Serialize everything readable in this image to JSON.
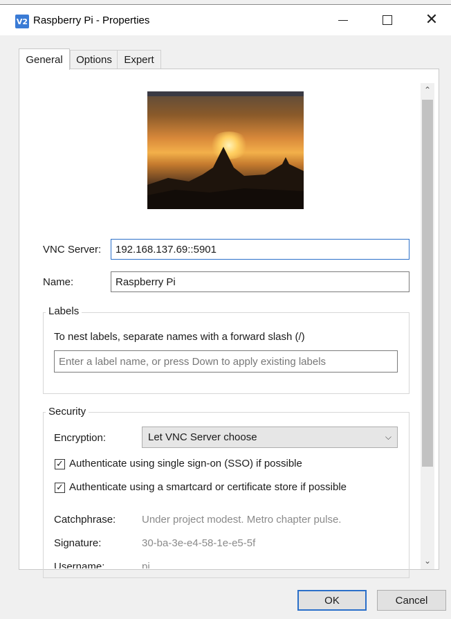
{
  "window": {
    "title": "Raspberry Pi - Properties",
    "app_icon": "V2"
  },
  "tabs": [
    {
      "label": "General",
      "active": true
    },
    {
      "label": "Options",
      "active": false
    },
    {
      "label": "Expert",
      "active": false
    }
  ],
  "general": {
    "vnc_server_label": "VNC Server:",
    "vnc_server_value": "192.168.137.69::5901",
    "name_label": "Name:",
    "name_value": "Raspberry Pi"
  },
  "labels_group": {
    "title": "Labels",
    "hint": "To nest labels, separate names with a forward slash (/)",
    "placeholder": "Enter a label name, or press Down to apply existing labels"
  },
  "security": {
    "title": "Security",
    "encryption_label": "Encryption:",
    "encryption_value": "Let VNC Server choose",
    "sso_label": "Authenticate using single sign-on (SSO) if possible",
    "sso_checked": true,
    "smartcard_label": "Authenticate using a smartcard or certificate store if possible",
    "smartcard_checked": true,
    "catchphrase_label": "Catchphrase:",
    "catchphrase_value": "Under project modest. Metro chapter pulse.",
    "signature_label": "Signature:",
    "signature_value": "30-ba-3e-e4-58-1e-e5-5f",
    "username_label": "Username:",
    "username_value": "pi"
  },
  "buttons": {
    "ok": "OK",
    "cancel": "Cancel"
  },
  "icons": {
    "check": "✓",
    "chevron_down": "⌵",
    "scroll_up": "⌃",
    "scroll_down": "⌄",
    "close": "✕"
  },
  "colors": {
    "accent": "#2a6fc9",
    "app_icon_bg": "#3a7bd5"
  }
}
